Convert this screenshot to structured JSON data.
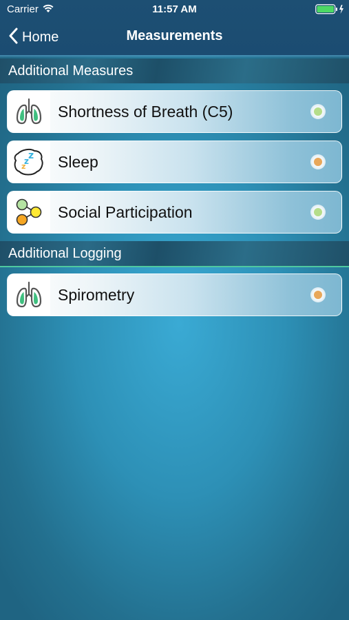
{
  "status_bar": {
    "carrier": "Carrier",
    "time": "11:57 AM"
  },
  "nav": {
    "back_label": "Home",
    "title": "Measurements"
  },
  "sections": [
    {
      "title": "Additional Measures",
      "items": [
        {
          "label": "Shortness of Breath (C5)",
          "icon": "lungs-icon",
          "status_color": "#b5dd8a"
        },
        {
          "label": "Sleep",
          "icon": "sleep-icon",
          "status_color": "#e8a75a"
        },
        {
          "label": "Social Participation",
          "icon": "social-participation-icon",
          "status_color": "#b5dd8a"
        }
      ]
    },
    {
      "title": "Additional Logging",
      "items": [
        {
          "label": "Spirometry",
          "icon": "lungs-icon",
          "status_color": "#e8a75a"
        }
      ]
    }
  ],
  "colors": {
    "nav_background": "#1b4c72",
    "background_accent": "#3aaad4",
    "status_good": "#b5dd8a",
    "status_warning": "#e8a75a",
    "logging_divider": "#4fc9a0"
  }
}
